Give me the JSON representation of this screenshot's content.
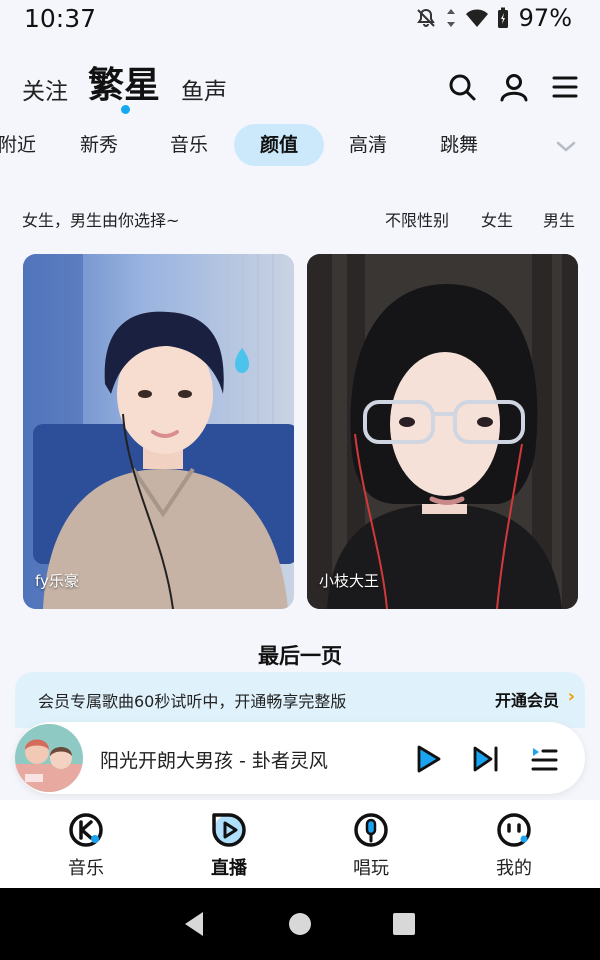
{
  "status_bar": {
    "time": "10:37",
    "battery_percent": "97%",
    "icons": [
      "mute-notification-icon",
      "data-arrows-icon",
      "wifi-icon",
      "battery-icon"
    ]
  },
  "top_nav": {
    "tabs": [
      {
        "label": "关注",
        "active": false
      },
      {
        "label": "繁星",
        "active": true
      },
      {
        "label": "鱼声",
        "active": false
      }
    ],
    "icons": [
      "search-icon",
      "profile-icon",
      "menu-icon"
    ],
    "accent_color": "#16a8ee"
  },
  "categories": {
    "items": [
      "附近",
      "新秀",
      "音乐",
      "颜值",
      "高清",
      "跳舞"
    ],
    "selected": "颜值",
    "selected_bg": "#cce9fb"
  },
  "filter": {
    "hint": "女生，男生由你选择~",
    "options": [
      "不限性别",
      "女生",
      "男生"
    ]
  },
  "streams": [
    {
      "name": "fy乐豪"
    },
    {
      "name": "小枝大王"
    }
  ],
  "end_label": "最后一页",
  "vip_banner": {
    "text": "会员专属歌曲60秒试听中，开通畅享完整版",
    "action": "开通会员",
    "chevron": "›"
  },
  "player": {
    "title": "阳光开朗大男孩",
    "separator": "-",
    "artist": "卦者灵风",
    "title_line": "阳光开朗大男孩  -  卦者灵风",
    "icons": [
      "play-icon",
      "next-icon",
      "playlist-icon"
    ],
    "accent_color": "#1aa3f0"
  },
  "bottom_nav": {
    "items": [
      {
        "label": "音乐",
        "icon": "k-music-icon",
        "active": false
      },
      {
        "label": "直播",
        "icon": "live-play-icon",
        "active": true
      },
      {
        "label": "唱玩",
        "icon": "microphone-icon",
        "active": false
      },
      {
        "label": "我的",
        "icon": "face-icon",
        "active": false
      }
    ]
  },
  "system_nav": {
    "icons": [
      "back-icon",
      "home-icon",
      "recents-icon"
    ]
  }
}
